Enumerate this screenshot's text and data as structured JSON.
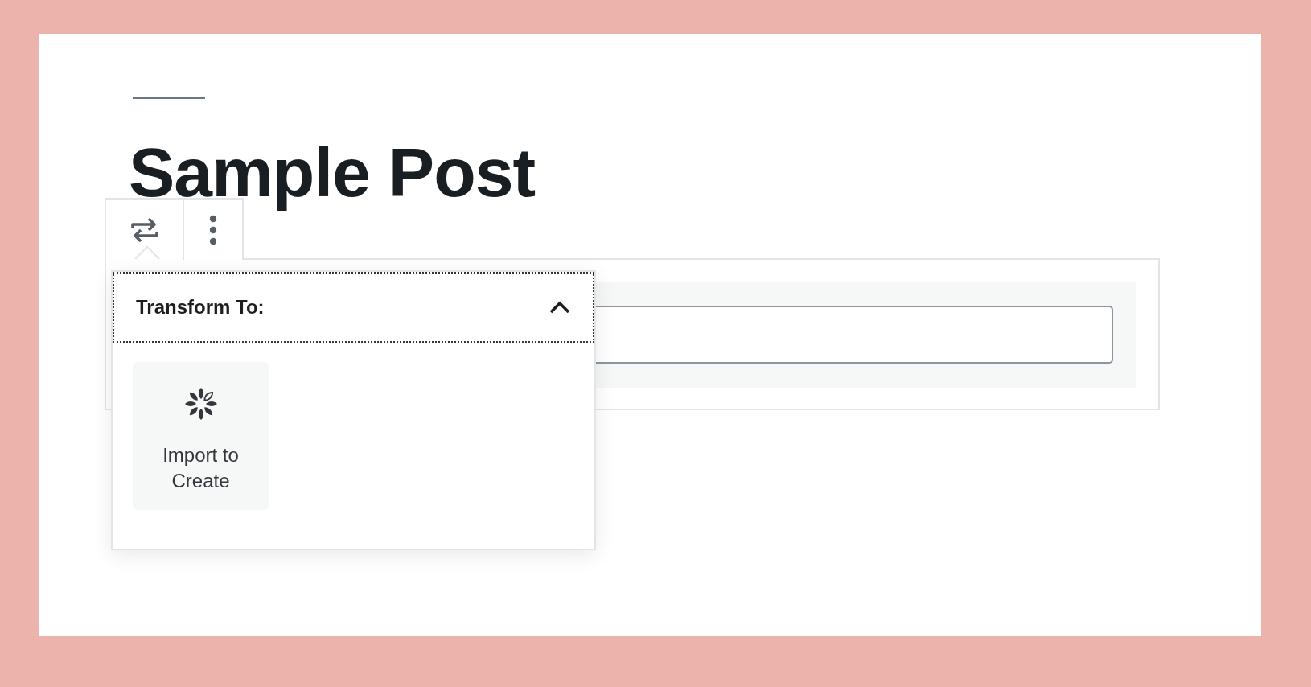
{
  "post": {
    "title": "Sample Post"
  },
  "transform_menu": {
    "heading": "Transform To:",
    "expanded": true,
    "options": [
      {
        "label": "Import to Create"
      }
    ]
  }
}
